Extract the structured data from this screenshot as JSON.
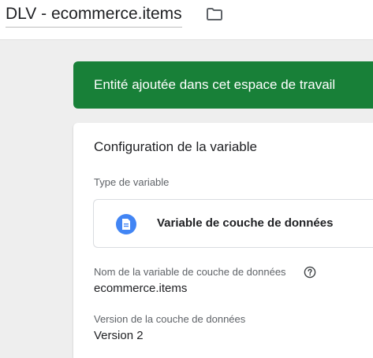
{
  "header": {
    "title": "DLV - ecommerce.items",
    "folder_icon": "folder-icon"
  },
  "banner": {
    "text": "Entité ajoutée dans cet espace de travail",
    "color": "#188038"
  },
  "card": {
    "title": "Configuration de la variable",
    "type_label": "Type de variable",
    "type_name": "Variable de couche de données",
    "type_icon": "document-icon",
    "type_icon_color": "#4285f4",
    "name_label": "Nom de la variable de couche de données",
    "name_help_icon": "help-icon",
    "name_value": "ecommerce.items",
    "version_label": "Version de la couche de données",
    "version_value": "Version 2"
  }
}
